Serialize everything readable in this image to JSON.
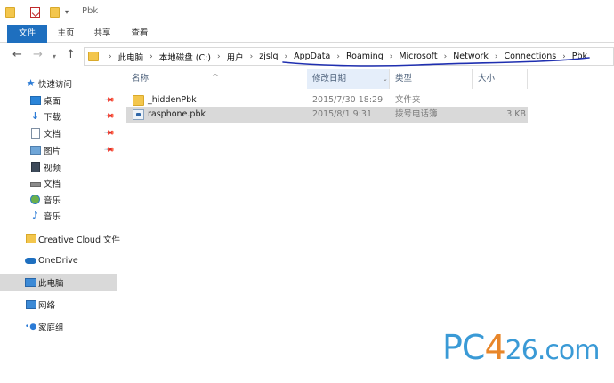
{
  "window": {
    "title": "Pbk"
  },
  "ribbon": {
    "tabs": [
      {
        "label": "文件"
      },
      {
        "label": "主页"
      },
      {
        "label": "共享"
      },
      {
        "label": "查看"
      }
    ]
  },
  "address": {
    "crumbs": [
      "此电脑",
      "本地磁盘 (C:)",
      "用户",
      "zjslq",
      "AppData",
      "Roaming",
      "Microsoft",
      "Network",
      "Connections",
      "Pbk"
    ]
  },
  "sidebar": {
    "items": [
      {
        "label": "快速访问",
        "icon": "star-icon"
      },
      {
        "label": "桌面",
        "icon": "desktop-icon",
        "pinned": true
      },
      {
        "label": "下载",
        "icon": "download-icon",
        "pinned": true
      },
      {
        "label": "文档",
        "icon": "document-icon",
        "pinned": true
      },
      {
        "label": "图片",
        "icon": "picture-icon",
        "pinned": true
      },
      {
        "label": "视频",
        "icon": "video-icon"
      },
      {
        "label": "文档",
        "icon": "drive-icon"
      },
      {
        "label": "音乐",
        "icon": "music-disc-icon"
      },
      {
        "label": "音乐",
        "icon": "music-note-icon"
      },
      {
        "label": "Creative Cloud 文件",
        "icon": "creative-cloud-icon"
      },
      {
        "label": "OneDrive",
        "icon": "onedrive-icon"
      },
      {
        "label": "此电脑",
        "icon": "computer-icon",
        "selected": true
      },
      {
        "label": "网络",
        "icon": "network-icon"
      },
      {
        "label": "家庭组",
        "icon": "homegroup-icon"
      }
    ]
  },
  "file_list": {
    "columns": {
      "name": "名称",
      "date": "修改日期",
      "type": "类型",
      "size": "大小"
    },
    "rows": [
      {
        "name": "_hiddenPbk",
        "date": "2015/7/30 18:29",
        "type": "文件夹",
        "size": "",
        "icon": "folder-icon"
      },
      {
        "name": "rasphone.pbk",
        "date": "2015/8/1 9:31",
        "type": "拨号电话簿",
        "size": "3 KB",
        "icon": "phonebook-file-icon",
        "selected": true
      }
    ]
  },
  "watermark": {
    "part1": "PC",
    "part2": "4",
    "part3": "26.com"
  },
  "colors": {
    "accent": "#1e6fbf",
    "selection": "#d9d9d9",
    "folder": "#f3c64d",
    "annotation": "#1f2fb0",
    "watermark_blue": "#3a9ad6",
    "watermark_orange": "#e8862a"
  }
}
